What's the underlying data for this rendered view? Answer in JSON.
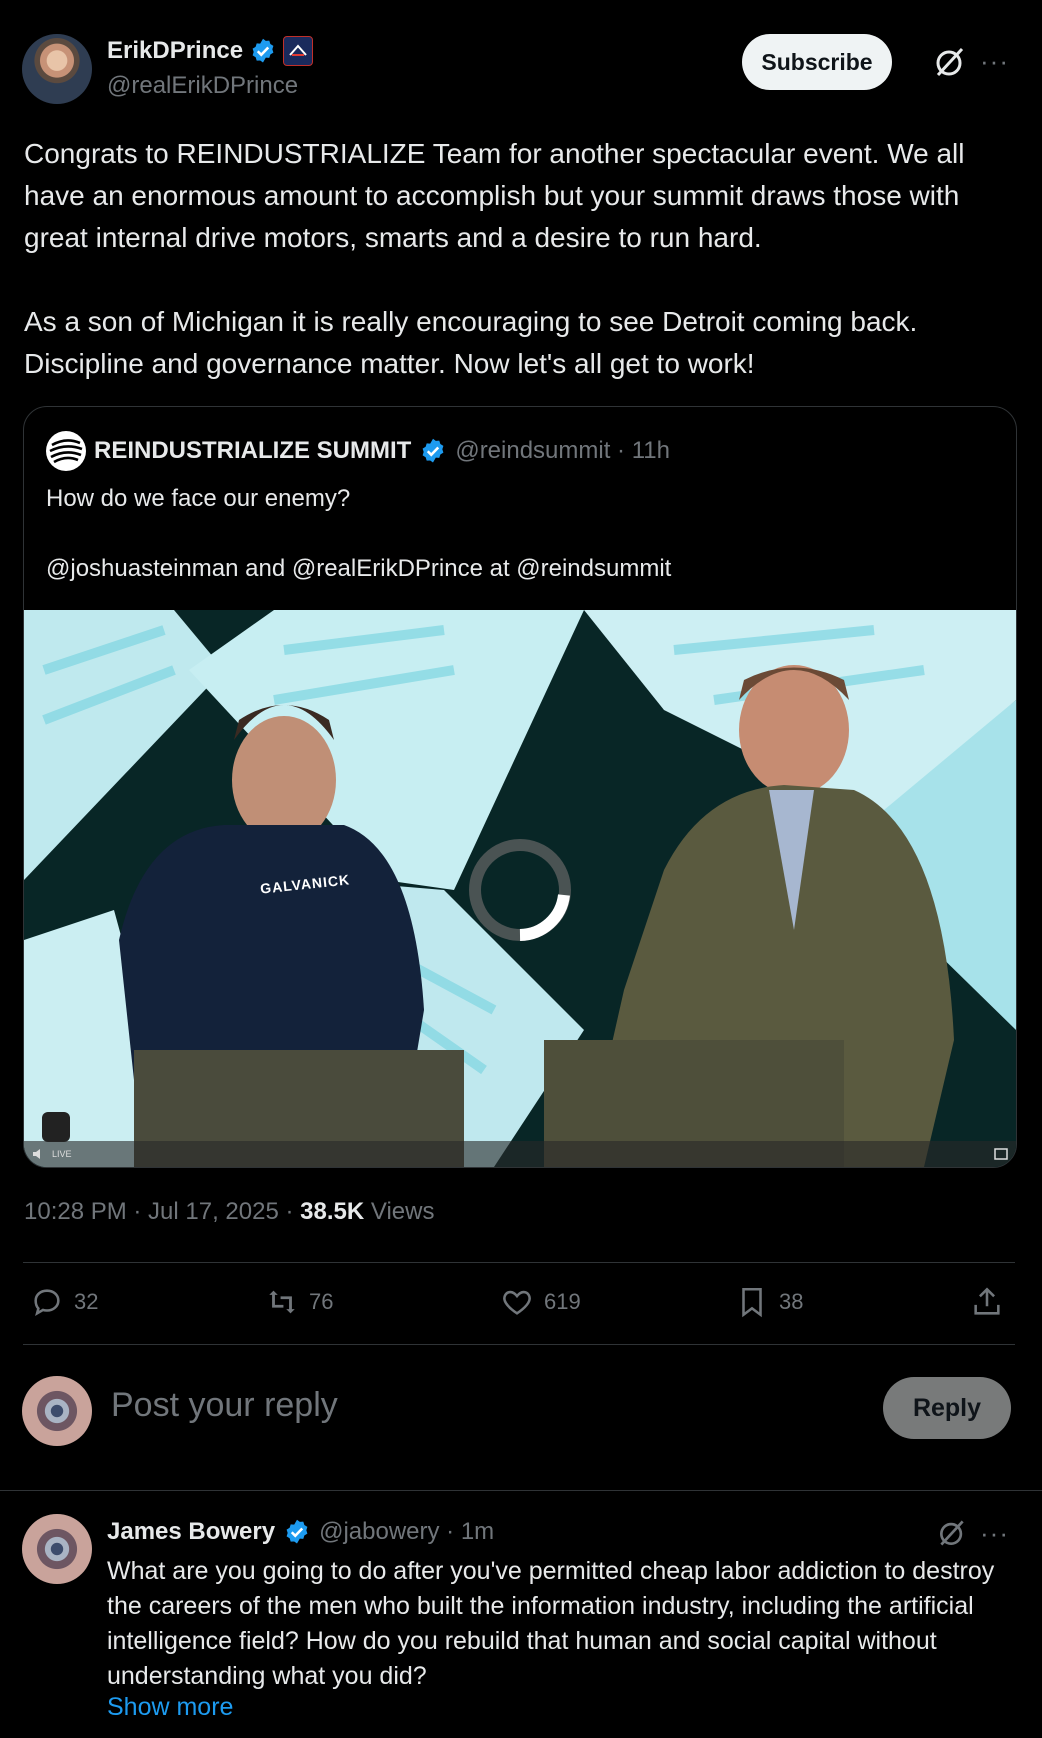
{
  "post": {
    "author_name": "ErikDPrince",
    "author_handle": "@realErikDPrince",
    "subscribe_label": "Subscribe",
    "text": "Congrats to REINDUSTRIALIZE Team for another spectacular event. We all have an enormous amount to accomplish but your summit draws those with great internal drive motors, smarts and a desire to run hard.\n\nAs a son of Michigan it is really encouraging to see Detroit coming back. Discipline and governance matter.  Now let's all get to work!",
    "time": "10:28 PM · Jul 17, 2025 · ",
    "views_count": "38.5K",
    "views_label": " Views"
  },
  "quote": {
    "author_name": "REINDUSTRIALIZE SUMMIT",
    "author_handle": "@reindsummit · 11h",
    "text": "How do we face our enemy?\n\n@joshuasteinman and @realErikDPrince at @reindsummit",
    "video_live_label": "LIVE",
    "hoodie_text": "GALVANICK"
  },
  "actions": {
    "replies": "32",
    "reposts": "76",
    "likes": "619",
    "bookmarks": "38"
  },
  "composer": {
    "placeholder": "Post your reply",
    "reply_label": "Reply"
  },
  "reply": {
    "author_name": "James Bowery",
    "author_handle": "@jabowery · 1m",
    "text": "What are you going to do after you've permitted cheap labor addiction to destroy the careers of the men who built the information industry, including the artificial intelligence field?  How do you rebuild that human and social capital without understanding what you did?",
    "show_more": "Show more"
  },
  "colors": {
    "background": "#000000",
    "text": "#e7e9ea",
    "muted": "#71767b",
    "accent": "#1d9bf0",
    "divider": "#2f3336"
  },
  "icons": [
    "verified-badge-icon",
    "affiliation-badge-icon",
    "grok-icon",
    "more-icon",
    "reply-icon",
    "repost-icon",
    "like-icon",
    "bookmark-icon",
    "share-icon",
    "speaker-icon",
    "fullscreen-icon",
    "loading-spinner-icon"
  ]
}
